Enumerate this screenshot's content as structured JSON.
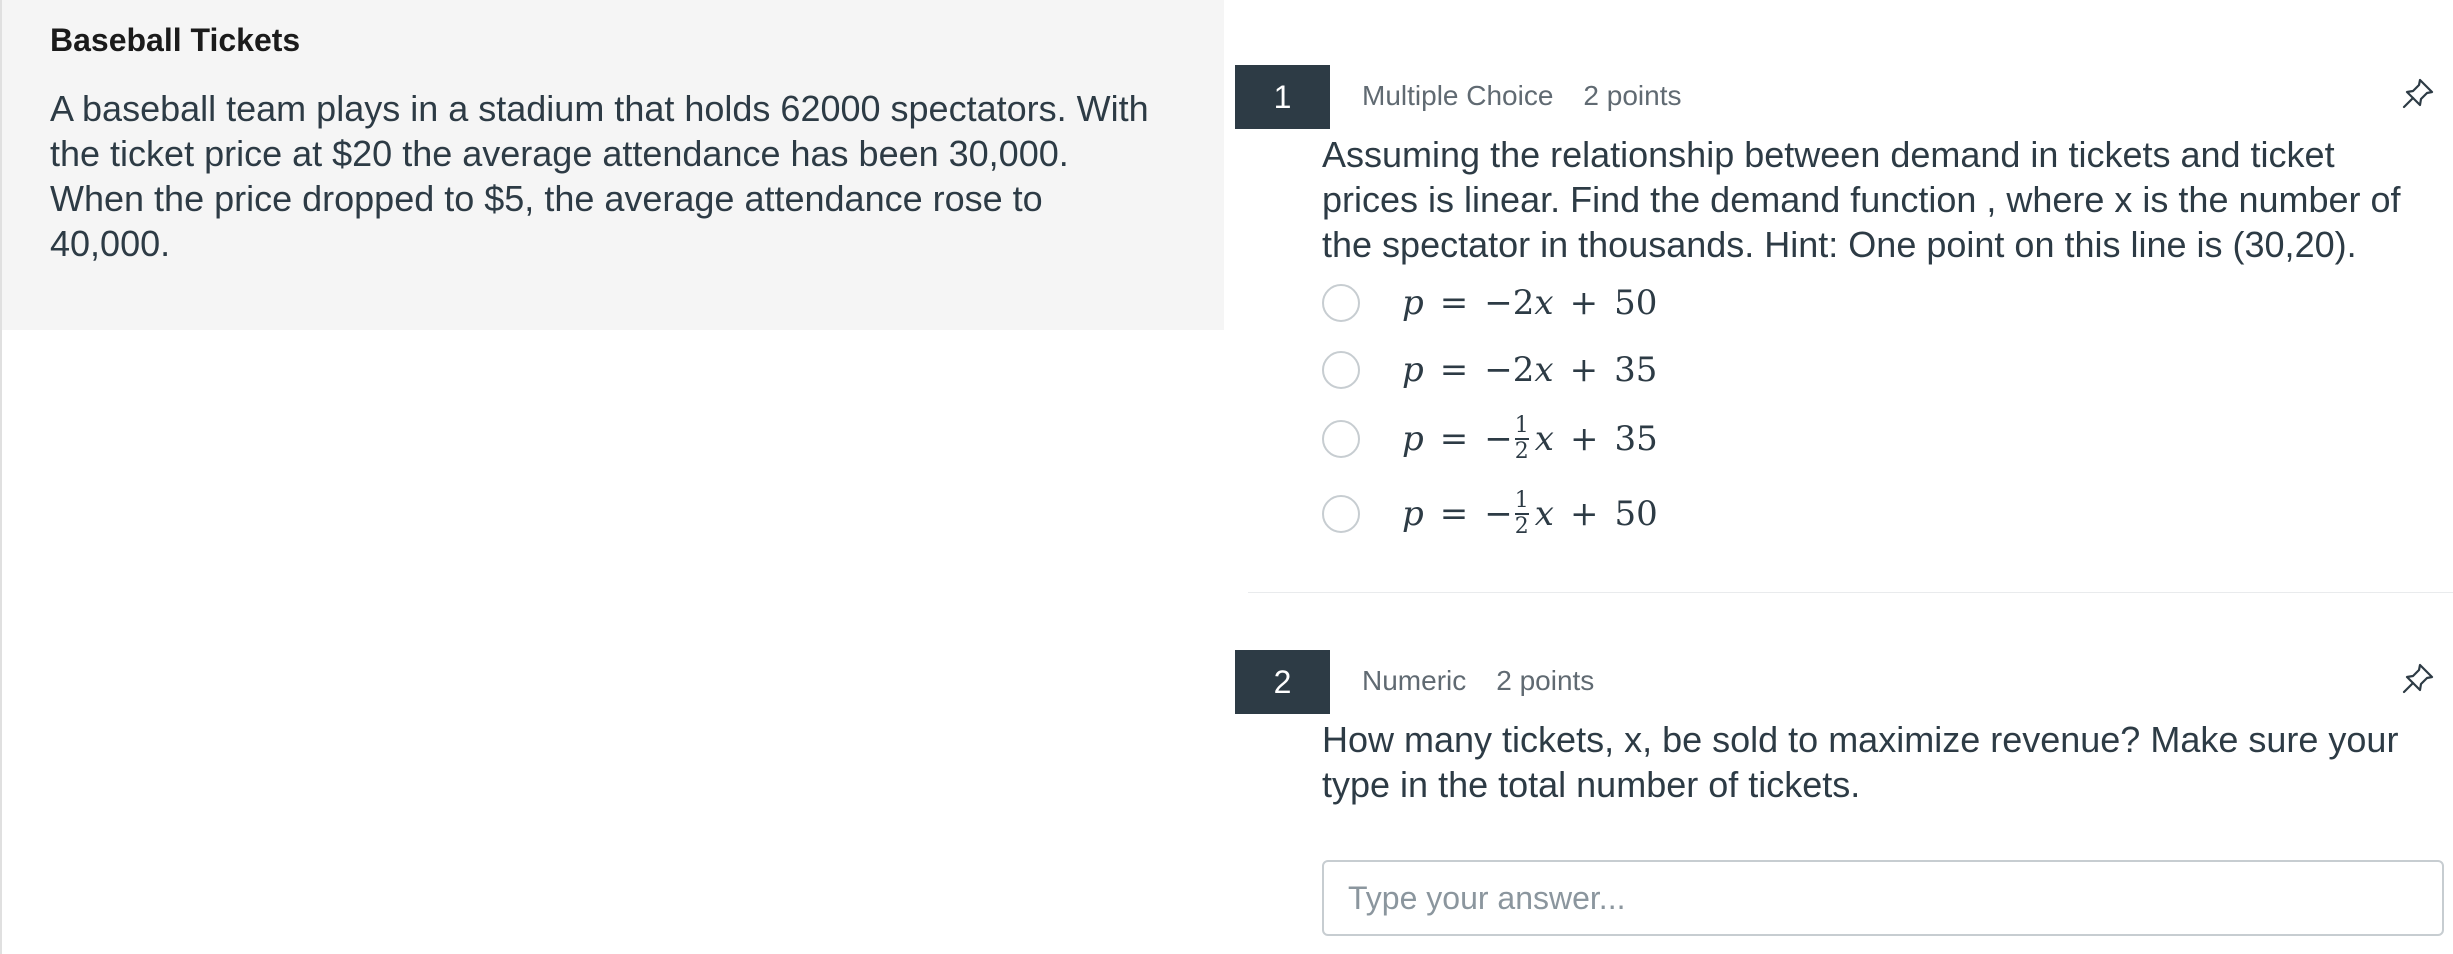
{
  "passage": {
    "title": "Baseball Tickets",
    "lines": [
      "A baseball team plays in a stadium that holds 62000 spectators. With",
      "the ticket price at $20 the average attendance has been 30,000.",
      "When the price dropped to $5, the average attendance rose to",
      "40,000."
    ]
  },
  "questions": [
    {
      "number": "1",
      "type": "Multiple Choice",
      "points": "2 points",
      "lines": [
        "Assuming the relationship between demand in tickets and ticket",
        "prices is linear. Find the demand function , where x is the number of",
        "the spectator in thousands.  Hint: One point on this line is (30,20)."
      ],
      "options": [
        {
          "lhs": "p",
          "eq": "=",
          "sign": "−",
          "coef": "2",
          "frac_num": "",
          "frac_den": "",
          "var": "x",
          "plus": "+",
          "const": "50"
        },
        {
          "lhs": "p",
          "eq": "=",
          "sign": "−",
          "coef": "2",
          "frac_num": "",
          "frac_den": "",
          "var": "x",
          "plus": "+",
          "const": "35"
        },
        {
          "lhs": "p",
          "eq": "=",
          "sign": "−",
          "coef": "",
          "frac_num": "1",
          "frac_den": "2",
          "var": "x",
          "plus": "+",
          "const": "35"
        },
        {
          "lhs": "p",
          "eq": "=",
          "sign": "−",
          "coef": "",
          "frac_num": "1",
          "frac_den": "2",
          "var": "x",
          "plus": "+",
          "const": "50"
        }
      ]
    },
    {
      "number": "2",
      "type": "Numeric",
      "points": "2 points",
      "lines": [
        "How many tickets, x, be sold to maximize revenue? Make sure your",
        "type in the total number of tickets."
      ],
      "answer_placeholder": "Type your answer..."
    }
  ],
  "icons": {
    "pin": "pin-icon"
  },
  "colors": {
    "badge": "#2d3b45",
    "panel": "#f5f5f5",
    "text": "#2d3b45"
  }
}
